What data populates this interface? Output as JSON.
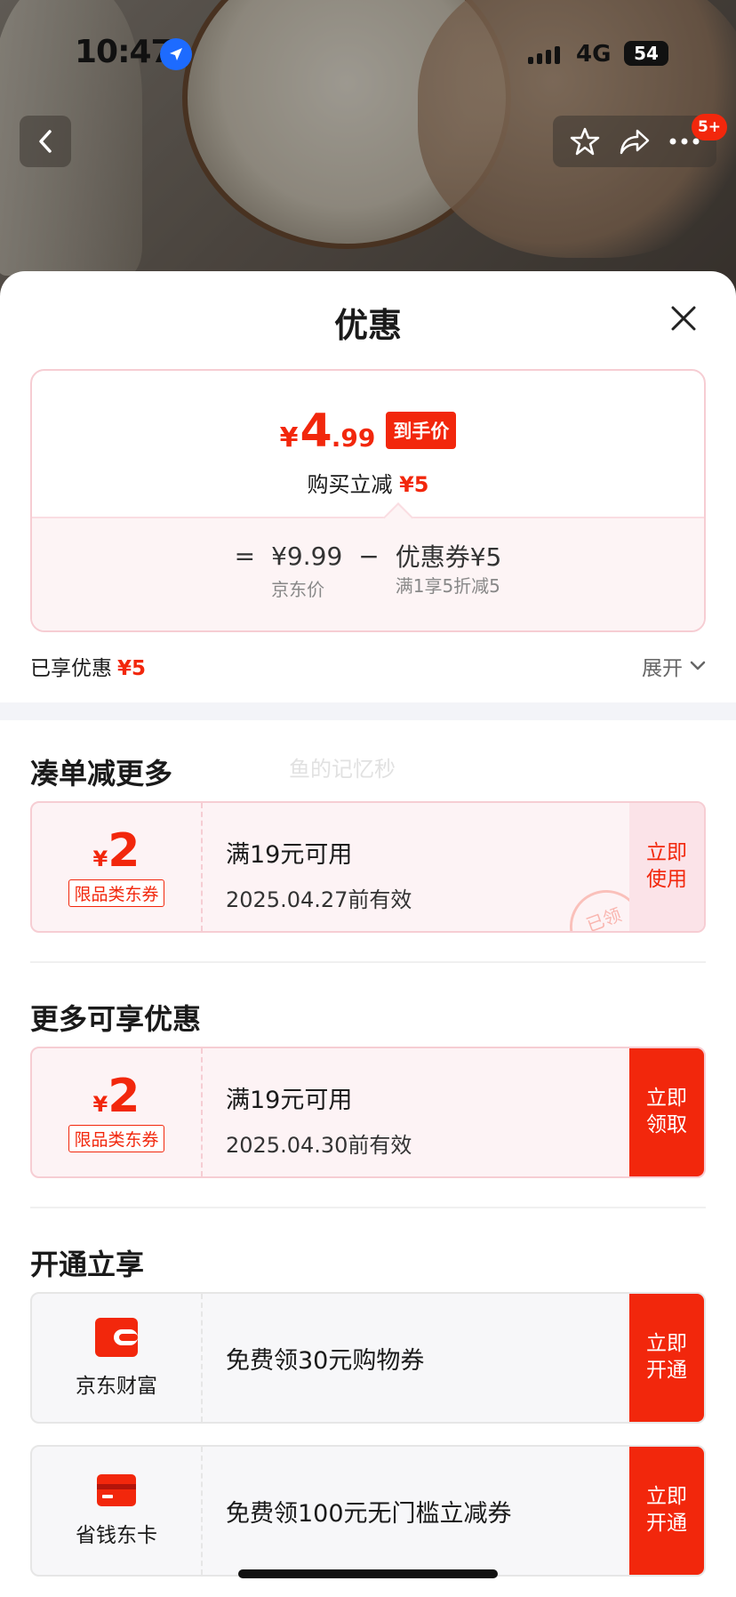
{
  "status_bar": {
    "time": "10:47",
    "network": "4G",
    "battery": "54"
  },
  "nav": {
    "badge": "5+"
  },
  "sheet": {
    "title": "优惠"
  },
  "price_card": {
    "currency": "¥",
    "final_int": "4",
    "final_dec": ".99",
    "final_tag": "到手价",
    "instant_label": "购买立减",
    "instant_value": "¥5",
    "equals": "=",
    "jd_price": "¥9.99",
    "jd_price_label": "京东价",
    "minus": "−",
    "coupon_value": "优惠券¥5",
    "coupon_label": "满1享5折减5"
  },
  "enjoyed": {
    "label": "已享优惠",
    "value": "¥5",
    "expand": "展开"
  },
  "sections": {
    "combine": "凑单减更多",
    "more": "更多可享优惠",
    "open": "开通立享"
  },
  "watermark": "鱼的记忆秒",
  "coupons": [
    {
      "currency": "¥",
      "amount": "2",
      "tag": "限品类东券",
      "condition": "满19元可用",
      "date": "2025.04.27前有效",
      "action_line1": "立即",
      "action_line2": "使用",
      "stamp": "已领"
    },
    {
      "currency": "¥",
      "amount": "2",
      "tag": "限品类东券",
      "condition": "满19元可用",
      "date": "2025.04.30前有效",
      "action_line1": "立即",
      "action_line2": "领取"
    }
  ],
  "services": [
    {
      "name": "京东财富",
      "text": "免费领30元购物券",
      "action_line1": "立即",
      "action_line2": "开通",
      "icon": "wallet-icon"
    },
    {
      "name": "省钱东卡",
      "text": "免费领100元无门槛立减券",
      "action_line1": "立即",
      "action_line2": "开通",
      "icon": "card-icon"
    }
  ],
  "colors": {
    "accent": "#f2270c",
    "pink_border": "#f6cdd3",
    "pink_bg": "#fdf3f5"
  }
}
